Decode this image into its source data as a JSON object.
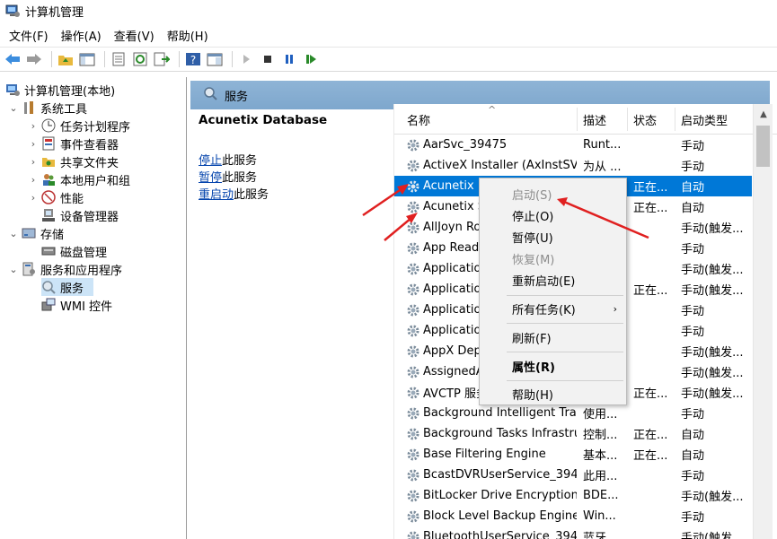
{
  "window": {
    "title": "计算机管理"
  },
  "menubar": [
    "文件(F)",
    "操作(A)",
    "查看(V)",
    "帮助(H)"
  ],
  "tree": {
    "root": "计算机管理(本地)",
    "system_tools": "系统工具",
    "task_scheduler": "任务计划程序",
    "event_viewer": "事件查看器",
    "shared_folders": "共享文件夹",
    "local_users": "本地用户和组",
    "performance": "性能",
    "device_manager": "设备管理器",
    "storage": "存储",
    "disk_management": "磁盘管理",
    "services_apps": "服务和应用程序",
    "services": "服务",
    "wmi": "WMI 控件"
  },
  "panel": {
    "header": "服务"
  },
  "desc_pane": {
    "service_name": "Acunetix Database",
    "stop_link": "停止",
    "stop_suffix": "此服务",
    "pause_link": "暂停",
    "pause_suffix": "此服务",
    "restart_link": "重启动",
    "restart_suffix": "此服务"
  },
  "columns": {
    "name": "名称",
    "desc": "描述",
    "status": "状态",
    "startup": "启动类型"
  },
  "rows": [
    {
      "name": "AarSvc_39475",
      "desc": "Runt...",
      "status": "",
      "startup": "手动"
    },
    {
      "name": "ActiveX Installer (AxInstSV)",
      "desc": "为从 ...",
      "status": "",
      "startup": "手动"
    },
    {
      "name": "Acunetix Datab",
      "desc": "",
      "status": "正在...",
      "startup": "自动"
    },
    {
      "name": "Acunetix S",
      "desc": "",
      "status": "正在...",
      "startup": "自动"
    },
    {
      "name": "AllJoyn Ro",
      "desc": "",
      "status": "",
      "startup": "手动(触发..."
    },
    {
      "name": "App Readi",
      "desc": "",
      "status": "",
      "startup": "手动"
    },
    {
      "name": "Application",
      "desc": "",
      "status": "",
      "startup": "手动(触发..."
    },
    {
      "name": "Application",
      "desc": "",
      "status": "正在...",
      "startup": "手动(触发..."
    },
    {
      "name": "Application",
      "desc": "",
      "status": "",
      "startup": "手动"
    },
    {
      "name": "Application",
      "desc": "",
      "status": "",
      "startup": "手动"
    },
    {
      "name": "AppX Dep",
      "desc": "",
      "status": "",
      "startup": "手动(触发..."
    },
    {
      "name": "AssignedA",
      "desc": "",
      "status": "",
      "startup": "手动(触发..."
    },
    {
      "name": "AVCTP 服务",
      "desc": "",
      "status": "正在...",
      "startup": "手动(触发..."
    },
    {
      "name": "Background Intelligent Tra...",
      "desc": "使用...",
      "status": "",
      "startup": "手动"
    },
    {
      "name": "Background Tasks Infrastru...",
      "desc": "控制...",
      "status": "正在...",
      "startup": "自动"
    },
    {
      "name": "Base Filtering Engine",
      "desc": "基本...",
      "status": "正在...",
      "startup": "自动"
    },
    {
      "name": "BcastDVRUserService_394...",
      "desc": "此用...",
      "status": "",
      "startup": "手动"
    },
    {
      "name": "BitLocker Drive Encryption ...",
      "desc": "BDE...",
      "status": "",
      "startup": "手动(触发..."
    },
    {
      "name": "Block Level Backup Engine ...",
      "desc": "Win...",
      "status": "",
      "startup": "手动"
    },
    {
      "name": "BluetoothUserService_394...",
      "desc": "蓝牙...",
      "status": "",
      "startup": "手动(触发..."
    }
  ],
  "context_menu": {
    "start": "启动(S)",
    "stop": "停止(O)",
    "pause": "暂停(U)",
    "resume": "恢复(M)",
    "restart": "重新启动(E)",
    "all_tasks": "所有任务(K)",
    "refresh": "刷新(F)",
    "properties": "属性(R)",
    "help": "帮助(H)"
  },
  "colors": {
    "selection": "#0078d7",
    "header_band": "#8fb4d6",
    "annotation_arrow": "#e02020"
  }
}
